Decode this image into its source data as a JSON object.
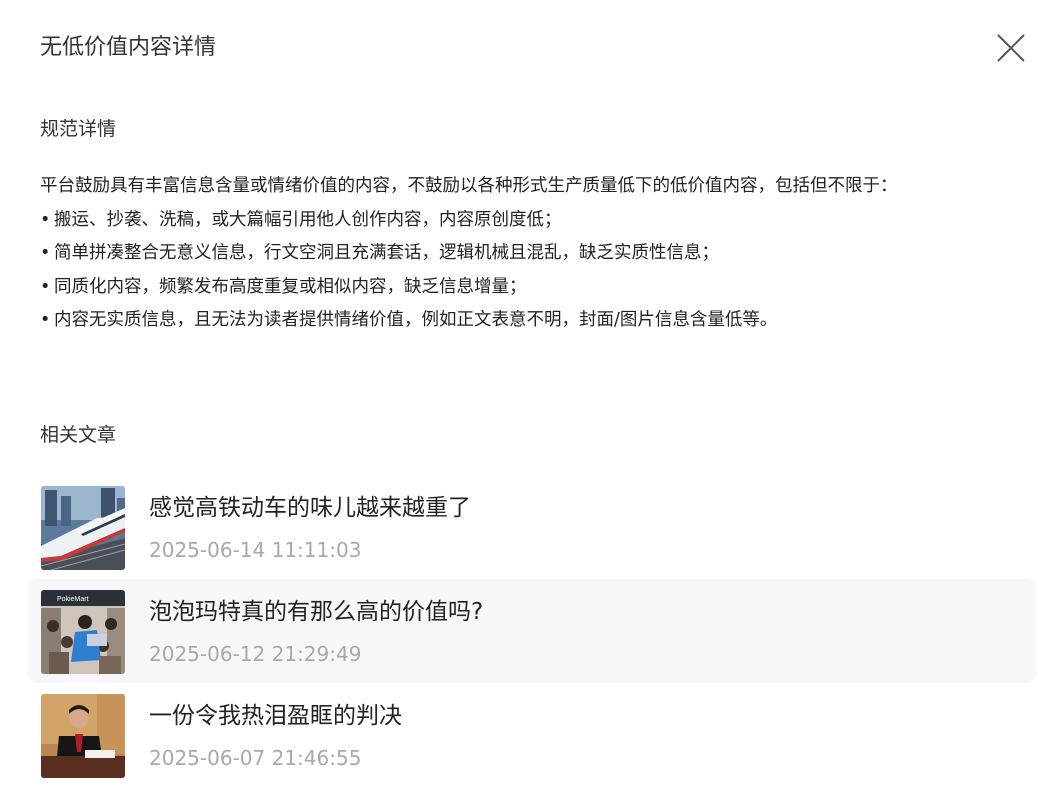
{
  "dialog": {
    "title": "无低价值内容详情",
    "close_icon": "close-icon"
  },
  "rules": {
    "heading": "规范详情",
    "intro": "平台鼓励具有丰富信息含量或情绪价值的内容，不鼓励以各种形式生产质量低下的低价值内容，包括但不限于：",
    "bullet": "•",
    "items": [
      "搬运、抄袭、洗稿，或大篇幅引用他人创作内容，内容原创度低；",
      "简单拼凑整合无意义信息，行文空洞且充满套话，逻辑机械且混乱，缺乏实质性信息；",
      "同质化内容，频繁发布高度重复或相似内容，缺乏信息增量；",
      "内容无实质信息，且无法为读者提供情绪价值，例如正文表意不明，封面/图片信息含量低等。"
    ]
  },
  "related": {
    "heading": "相关文章",
    "articles": [
      {
        "title": "感觉高铁动车的味儿越来越重了",
        "time": "2025-06-14 11:11:03",
        "thumbnail": "high-speed-train-thumbnail"
      },
      {
        "title": "泡泡玛特真的有那么高的价值吗?",
        "time": "2025-06-12 21:29:49",
        "thumbnail": "store-crowd-thumbnail",
        "sign_text": "PokieMart"
      },
      {
        "title": "一份令我热泪盈眶的判决",
        "time": "2025-06-07 21:46:55",
        "thumbnail": "judge-courtroom-thumbnail"
      }
    ]
  },
  "colors": {
    "title_text": "#333333",
    "body_text": "#222222",
    "timestamp": "#a9a9a9",
    "hover_row": "#f7f7f7",
    "close_icon": "#555555"
  }
}
